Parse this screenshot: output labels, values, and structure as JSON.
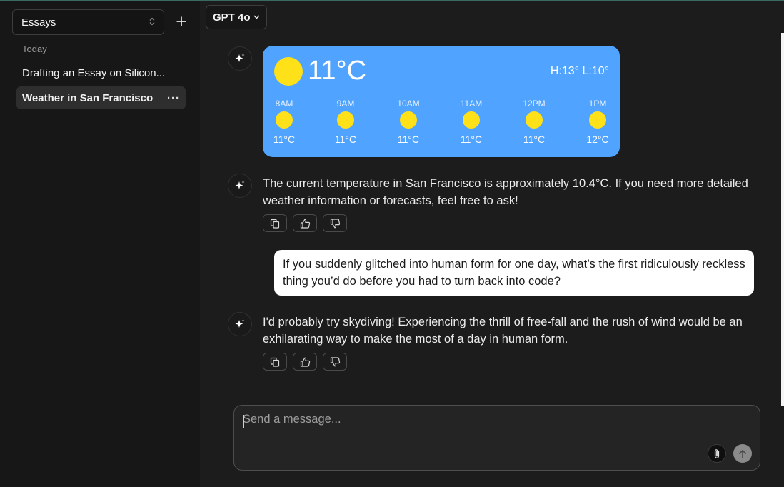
{
  "sidebar": {
    "folder": "Essays",
    "section_label": "Today",
    "chats": [
      {
        "label": "Drafting an Essay on Silicon..."
      },
      {
        "label": "Weather in San Francisco",
        "menu": "···"
      }
    ]
  },
  "header": {
    "model": "GPT 4o"
  },
  "weather_card": {
    "temperature": "11°C",
    "hi_lo": "H:13° L:10°",
    "hours": [
      {
        "time": "8AM",
        "temp": "11°C"
      },
      {
        "time": "9AM",
        "temp": "11°C"
      },
      {
        "time": "10AM",
        "temp": "11°C"
      },
      {
        "time": "11AM",
        "temp": "11°C"
      },
      {
        "time": "12PM",
        "temp": "11°C"
      },
      {
        "time": "1PM",
        "temp": "12°C"
      }
    ],
    "card_color": "#50a3ff",
    "sun_color": "#ffe119"
  },
  "messages": [
    {
      "role": "assistant",
      "text": "The current temperature in San Francisco is approximately 10.4°C. If you need more detailed weather information or forecasts, feel free to ask!"
    },
    {
      "role": "user",
      "text": "If you suddenly glitched into human form for one day, what’s the first ridiculously reckless thing you’d do before you had to turn back into code?"
    },
    {
      "role": "assistant",
      "text": "I'd probably try skydiving! Experiencing the thrill of free-fall and the rush of wind would be an exhilarating way to make the most of a day in human form."
    }
  ],
  "composer": {
    "placeholder": "Send a message..."
  },
  "icons": {
    "assistant_avatar": "sparkles-icon",
    "copy": "copy-icon",
    "upvote": "thumbs-up-icon",
    "downvote": "thumbs-down-icon",
    "attach": "paperclip-icon",
    "send": "arrow-up-icon",
    "new_chat": "plus-icon"
  }
}
